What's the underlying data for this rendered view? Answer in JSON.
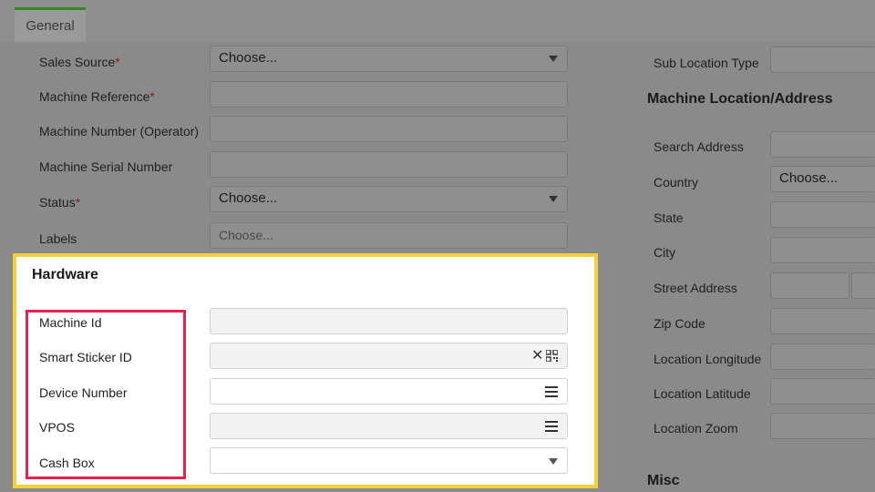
{
  "tab": {
    "label": "General"
  },
  "left_form": {
    "sales_source": {
      "label": "Sales Source",
      "value": "Choose..."
    },
    "machine_reference": {
      "label": "Machine Reference"
    },
    "machine_number": {
      "label": "Machine Number (Operator)"
    },
    "machine_serial": {
      "label": "Machine Serial Number"
    },
    "status": {
      "label": "Status",
      "value": "Choose..."
    },
    "labels": {
      "label": "Labels",
      "placeholder": "Choose..."
    },
    "required_mark": "*"
  },
  "hardware": {
    "title": "Hardware",
    "machine_id": {
      "label": "Machine Id"
    },
    "smart_sticker_id": {
      "label": "Smart Sticker ID"
    },
    "device_number": {
      "label": "Device Number"
    },
    "vpos": {
      "label": "VPOS"
    },
    "cash_box": {
      "label": "Cash Box"
    }
  },
  "right_form": {
    "sub_location_type": {
      "label": "Sub Location Type"
    },
    "location_title": "Machine Location/Address",
    "search_address": {
      "label": "Search Address"
    },
    "country": {
      "label": "Country",
      "value": "Choose..."
    },
    "state": {
      "label": "State"
    },
    "city": {
      "label": "City"
    },
    "street_address": {
      "label": "Street Address"
    },
    "zip_code": {
      "label": "Zip Code"
    },
    "location_longitude": {
      "label": "Location Longitude"
    },
    "location_latitude": {
      "label": "Location Latitude"
    },
    "location_zoom": {
      "label": "Location Zoom"
    },
    "misc_title": "Misc"
  },
  "colors": {
    "tab_accent": "#2e8b1e",
    "highlight_yellow": "#f4d03f",
    "highlight_red": "#e3234f"
  }
}
